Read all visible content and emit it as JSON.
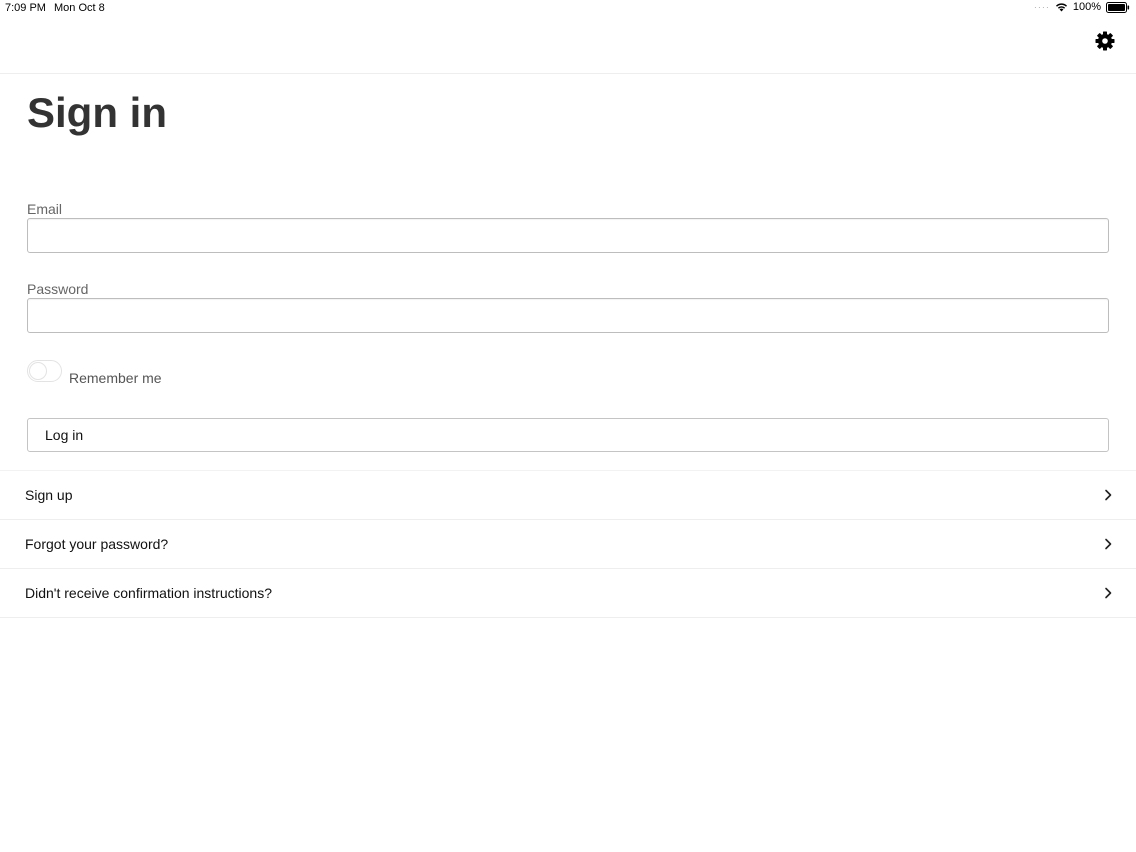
{
  "status_bar": {
    "time": "7:09 PM",
    "date": "Mon Oct 8",
    "battery": "100%"
  },
  "header": {
    "settings_icon": "gear-icon"
  },
  "page": {
    "title": "Sign in"
  },
  "form": {
    "email_label": "Email",
    "email_value": "",
    "password_label": "Password",
    "password_value": "",
    "remember_label": "Remember me",
    "remember_checked": false,
    "login_label": "Log in"
  },
  "links": [
    {
      "label": "Sign up",
      "icon": "chevron-right-icon"
    },
    {
      "label": "Forgot your password?",
      "icon": "chevron-right-icon"
    },
    {
      "label": "Didn't receive confirmation instructions?",
      "icon": "chevron-right-icon"
    }
  ]
}
